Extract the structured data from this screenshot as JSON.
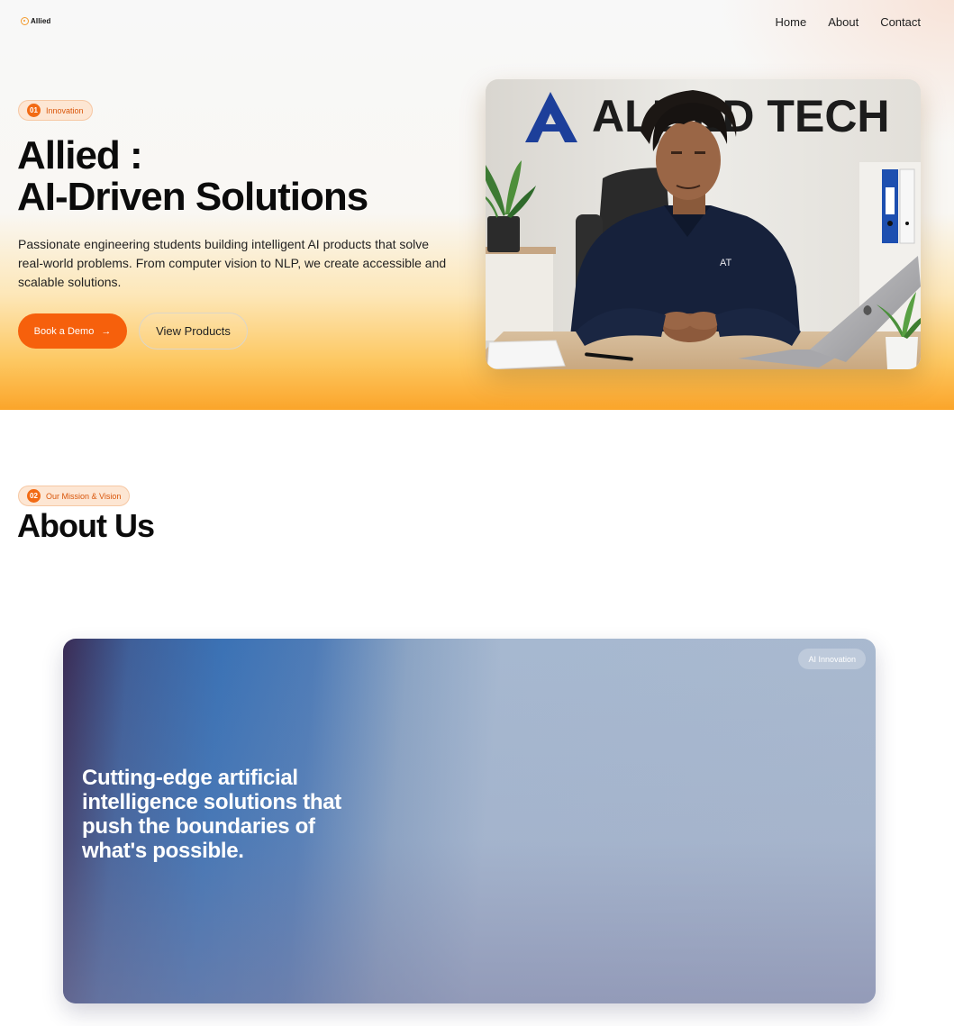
{
  "nav": {
    "logo_text": "Allied",
    "links": [
      "Home",
      "About",
      "Contact"
    ]
  },
  "hero": {
    "badge_num": "01",
    "badge_text": "Innovation",
    "title_line1": "Allied :",
    "title_line2": "AI-Driven Solutions",
    "description": "Passionate engineering students building intelligent AI products that solve real-world problems. From computer vision to NLP, we create accessible and scalable solutions.",
    "primary_button": "Book a Demo",
    "primary_button_icon": "→",
    "secondary_button": "View Products",
    "photo": {
      "wall_sign": "ALLIED TECH",
      "shirt_logo": "AT"
    }
  },
  "about": {
    "badge_num": "02",
    "badge_text": "Our Mission & Vision",
    "title": "About Us",
    "card_chip": "AI Innovation",
    "card_text": "Cutting-edge artificial intelligence solutions that push the boundaries of what's possible."
  },
  "colors": {
    "accent": "#f6600c",
    "badge_bg": "#fde6d3",
    "hero_bottom": "#fba52a"
  }
}
